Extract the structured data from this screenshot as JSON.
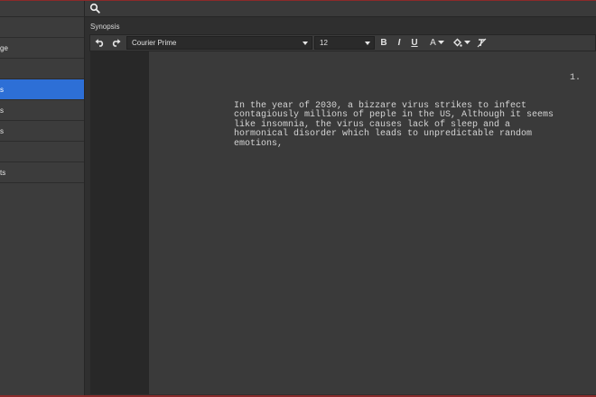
{
  "sidebar": {
    "items": [
      {
        "label": ""
      },
      {
        "label": "ge"
      },
      {
        "label": ""
      },
      {
        "label": "s"
      },
      {
        "label": "s"
      },
      {
        "label": "s"
      },
      {
        "label": ""
      },
      {
        "label": "ts"
      }
    ],
    "active_index": 3,
    "accent_color": "#2d6fd6"
  },
  "search": {
    "placeholder": ""
  },
  "synopsis": {
    "label": "Synopsis"
  },
  "toolbar": {
    "font": "Courier Prime",
    "size": "12",
    "bold": "B",
    "italic": "I",
    "underline": "U",
    "text_color": "A"
  },
  "editor": {
    "page_number": "1.",
    "text": "In the year of 2030, a bizzare virus strikes to infect\ncontagiously millions of peple in the US, Although it seems\nlike insomnia, the virus causes lack of sleep and a\nhormonical disorder which leads to unpredictable random\nemotions,"
  }
}
